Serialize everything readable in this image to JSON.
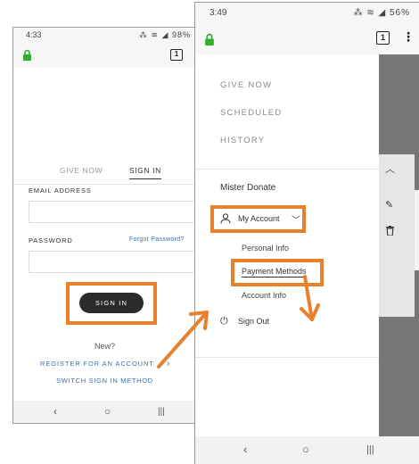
{
  "phone1": {
    "status_time": "4:33",
    "status_icons": "⁂ ≋ ◢ 98%",
    "tab_count": "1",
    "tabs": [
      "GIVE NOW",
      "SIGN IN"
    ],
    "email_label": "EMAIL ADDRESS",
    "password_label": "PASSWORD",
    "forgot_password": "Forgot Password?",
    "signin_button": "SIGN IN",
    "new_prompt": "New?",
    "register_link": "REGISTER FOR AN ACCOUNT",
    "switch_method": "SWITCH SIGN IN METHOD"
  },
  "phone2": {
    "status_time": "3:49",
    "status_icons": "⁂ ≋ ◢ 56%",
    "tab_count": "1",
    "menu": [
      "GIVE NOW",
      "SCHEDULED",
      "HISTORY"
    ],
    "user_name": "Mister Donate",
    "my_account": "My Account",
    "sub_items": [
      "Personal Info",
      "Payment Methods",
      "Account Info"
    ],
    "sign_out": "Sign Out"
  },
  "colors": {
    "highlight": "#e8802c",
    "link": "#3a6fb0",
    "lock": "#2fae2f",
    "button": "#2b2b2b"
  },
  "icons": {
    "lock": "lock-icon",
    "tabs": "tabs-counter-icon",
    "menu": "kebab-menu-icon",
    "person": "person-icon",
    "power": "power-icon",
    "nav_back": "‹",
    "nav_home": "○",
    "nav_recent": "|||"
  }
}
